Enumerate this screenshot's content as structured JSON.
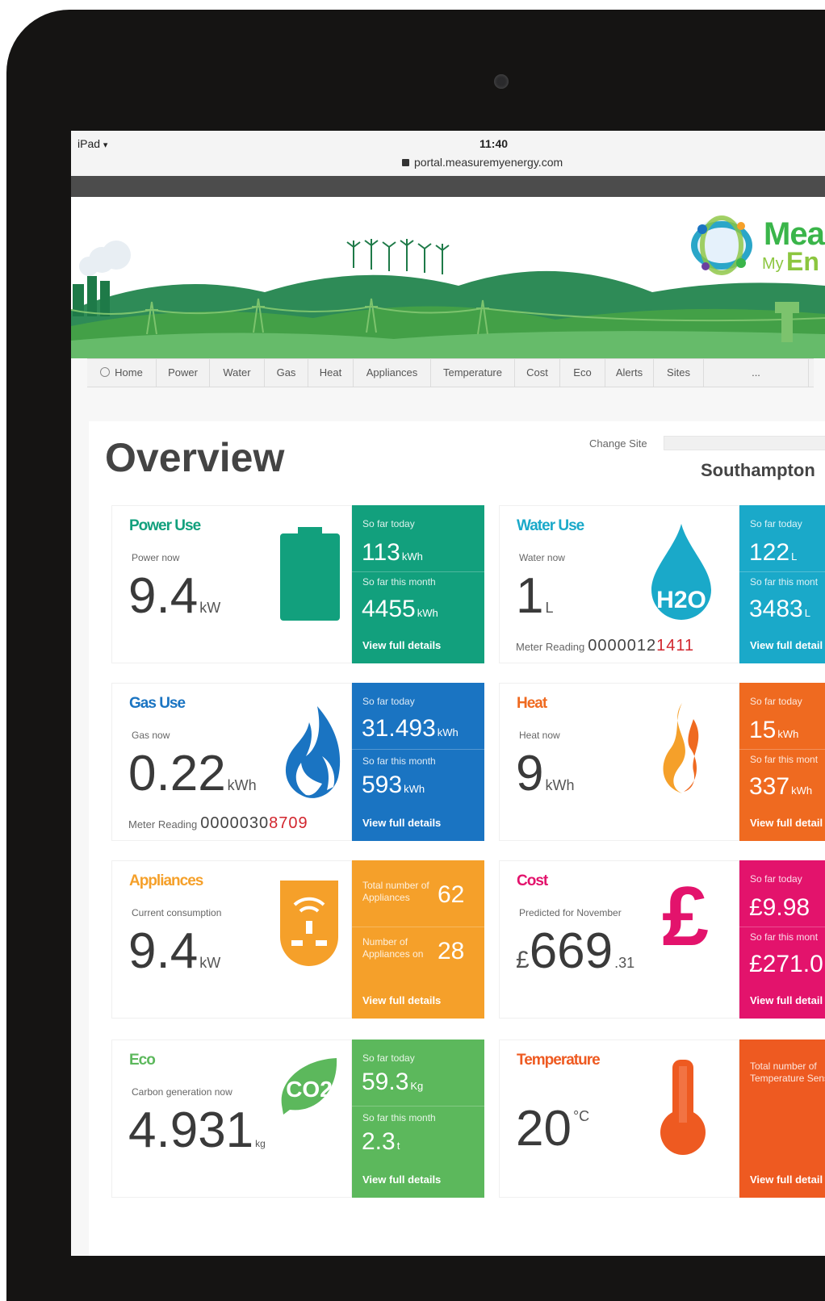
{
  "status": {
    "device": "iPad",
    "time": "11:40",
    "url": "portal.measuremyenergy.com"
  },
  "brand": {
    "line1": "Mea",
    "line2a": "My",
    "line2b": "En"
  },
  "nav": [
    "Home",
    "Power",
    "Water",
    "Gas",
    "Heat",
    "Appliances",
    "Temperature",
    "Cost",
    "Eco",
    "Alerts",
    "Sites",
    "..."
  ],
  "page": {
    "title": "Overview",
    "change_site_label": "Change Site",
    "site_name": "Southampton"
  },
  "cards": {
    "power": {
      "title": "Power Use",
      "sub": "Power now",
      "value": "9.4",
      "unit": "kW",
      "panel": {
        "l1": "So far today",
        "v1": "113",
        "u1": "kWh",
        "l2": "So far this month",
        "v2": "4455",
        "u2": "kWh",
        "link": "View full details"
      }
    },
    "water": {
      "title": "Water Use",
      "sub": "Water now",
      "value": "1",
      "unit": "L",
      "meter_label": "Meter Reading",
      "meter_black": "0000012",
      "meter_red": "1411",
      "panel": {
        "l1": "So far today",
        "v1": "122",
        "u1": "L",
        "l2": "So far this mont",
        "v2": "3483",
        "u2": "L",
        "link": "View full detail"
      }
    },
    "gas": {
      "title": "Gas Use",
      "sub": "Gas now",
      "value": "0.22",
      "unit": "kWh",
      "meter_label": "Meter Reading",
      "meter_black": "0000030",
      "meter_red": "8709",
      "panel": {
        "l1": "So far today",
        "v1": "31.493",
        "u1": "kWh",
        "l2": "So far this month",
        "v2": "593",
        "u2": "kWh",
        "link": "View full details"
      }
    },
    "heat": {
      "title": "Heat",
      "sub": "Heat now",
      "value": "9",
      "unit": "kWh",
      "panel": {
        "l1": "So far today",
        "v1": "15",
        "u1": "kWh",
        "l2": "So far this mont",
        "v2": "337",
        "u2": "kWh",
        "link": "View full detail"
      }
    },
    "appliances": {
      "title": "Appliances",
      "sub": "Current consumption",
      "value": "9.4",
      "unit": "kW",
      "panel": {
        "l1": "Total number of Appliances",
        "v1": "62",
        "l2": "Number of Appliances on",
        "v2": "28",
        "link": "View full details"
      }
    },
    "cost": {
      "title": "Cost",
      "sub": "Predicted for November",
      "currency": "£",
      "value": "669",
      "unit": ".31",
      "panel": {
        "l1": "So far today",
        "v1": "£9.98",
        "l2": "So far this mont",
        "v2": "£271.0",
        "link": "View full detail"
      }
    },
    "eco": {
      "title": "Eco",
      "sub": "Carbon generation now",
      "value": "4.931",
      "unit": "kg",
      "panel": {
        "l1": "So far today",
        "v1": "59.3",
        "u1": "Kg",
        "l2": "So far this month",
        "v2": "2.3",
        "u2": "t",
        "link": "View full details"
      }
    },
    "temperature": {
      "title": "Temperature",
      "value": "20",
      "unit": "°C",
      "panel": {
        "l1": "Total number of Temperature Sensors",
        "link": "View full detail"
      }
    }
  },
  "colors": {
    "power": "#12a07d",
    "water": "#1aa9c9",
    "gas": "#1a74c2",
    "heat": "#ef6a20",
    "appliances": "#f5a02a",
    "cost": "#e3136c",
    "eco": "#5cb85c",
    "temperature": "#ee5a21"
  }
}
